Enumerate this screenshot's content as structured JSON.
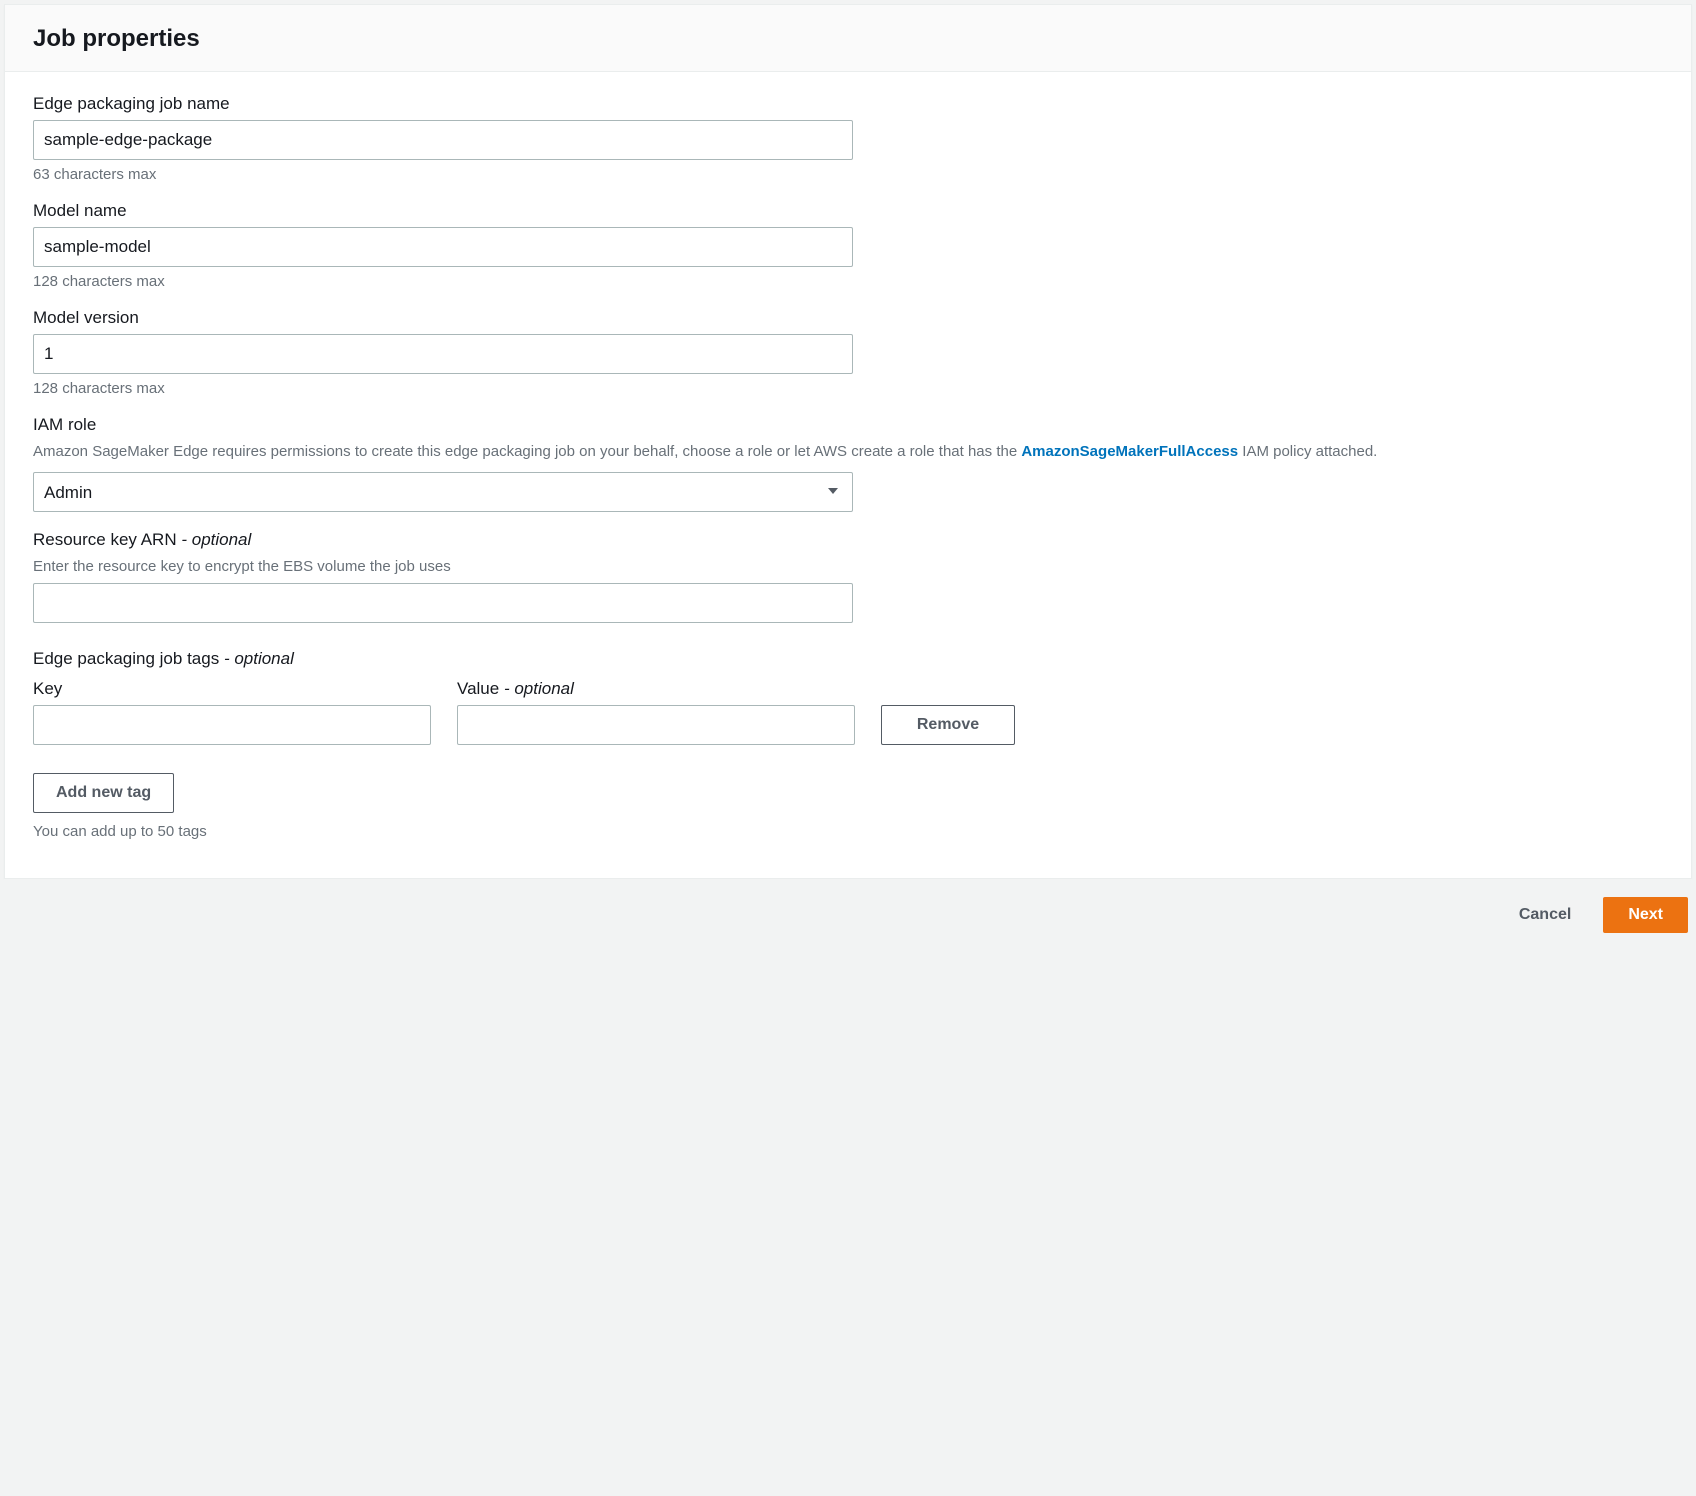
{
  "panel": {
    "title": "Job properties"
  },
  "fields": {
    "jobName": {
      "label": "Edge packaging job name",
      "value": "sample-edge-package",
      "hint": "63 characters max"
    },
    "modelName": {
      "label": "Model name",
      "value": "sample-model",
      "hint": "128 characters max"
    },
    "modelVersion": {
      "label": "Model version",
      "value": "1",
      "hint": "128 characters max"
    },
    "iamRole": {
      "label": "IAM role",
      "descPrefix": "Amazon SageMaker Edge requires permissions to create this edge packaging job on your behalf, choose a role or let AWS create a role that has the ",
      "linkText": "AmazonSageMakerFullAccess",
      "descSuffix": " IAM policy attached.",
      "value": "Admin"
    },
    "resourceKey": {
      "label": "Resource key ARN",
      "optional": "- optional",
      "desc": "Enter the resource key to encrypt the EBS volume the job uses",
      "value": ""
    },
    "tagsSection": {
      "label": "Edge packaging job tags",
      "optional": "- optional",
      "keyLabel": "Key",
      "valueLabel": "Value",
      "valueOptional": "- optional",
      "keyValue": "",
      "valueValue": "",
      "removeLabel": "Remove",
      "addLabel": "Add new tag",
      "hint": "You can add up to 50 tags"
    }
  },
  "footer": {
    "cancel": "Cancel",
    "next": "Next"
  }
}
